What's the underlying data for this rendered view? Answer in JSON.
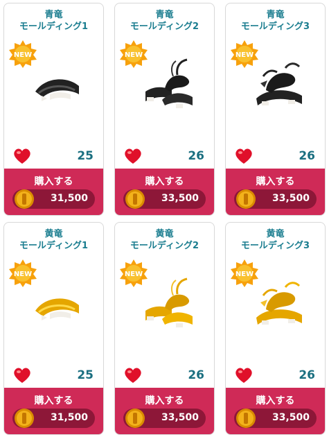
{
  "buy_label": "購入する",
  "new_badge": "NEW",
  "colors": {
    "title": "#1a7d8f",
    "likes": "#1a6f80",
    "buy_bg": "#cf2a57",
    "price_bg": "#8d1738",
    "heart": "#e0102a",
    "badge": "#f7a10c"
  },
  "items": [
    {
      "title_line1": "青竜",
      "title_line2": "モールディング1",
      "likes": "25",
      "price": "31,500",
      "variant": "black"
    },
    {
      "title_line1": "青竜",
      "title_line2": "モールディング2",
      "likes": "26",
      "price": "33,500",
      "variant": "black"
    },
    {
      "title_line1": "青竜",
      "title_line2": "モールディング3",
      "likes": "26",
      "price": "33,500",
      "variant": "black"
    },
    {
      "title_line1": "黄竜",
      "title_line2": "モールディング1",
      "likes": "25",
      "price": "31,500",
      "variant": "gold"
    },
    {
      "title_line1": "黄竜",
      "title_line2": "モールディング2",
      "likes": "26",
      "price": "33,500",
      "variant": "gold"
    },
    {
      "title_line1": "黄竜",
      "title_line2": "モールディング3",
      "likes": "26",
      "price": "33,500",
      "variant": "gold"
    }
  ]
}
